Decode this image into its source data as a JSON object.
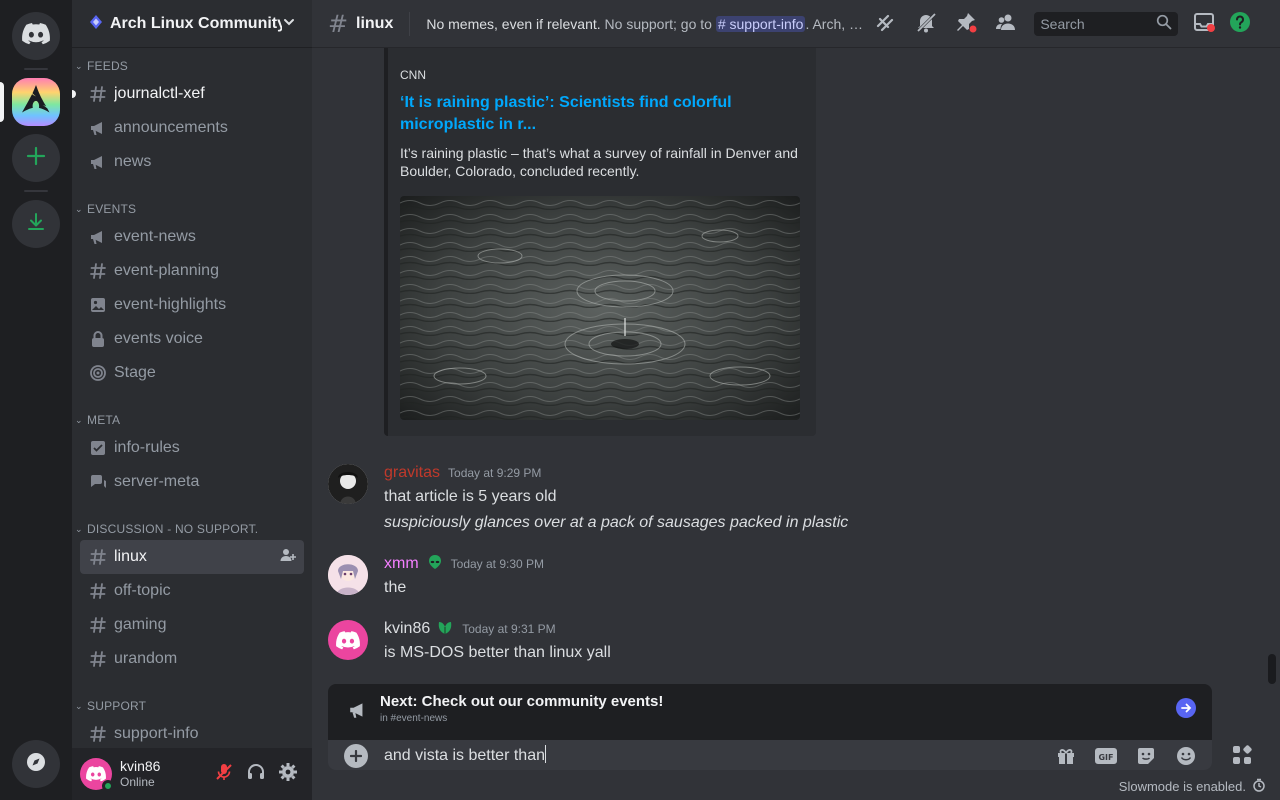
{
  "server": {
    "name": "Arch Linux Community"
  },
  "categories": {
    "feeds": "FEEDS",
    "events": "EVENTS",
    "meta": "META",
    "discussion": "DISCUSSION - NO SUPPORT.",
    "support": "SUPPORT"
  },
  "channels": {
    "journalctl": "journalctl-xef",
    "announcements": "announcements",
    "news": "news",
    "event_news": "event-news",
    "event_planning": "event-planning",
    "event_highlights": "event-highlights",
    "events_voice": "events voice",
    "stage": "Stage",
    "info_rules": "info-rules",
    "server_meta": "server-meta",
    "linux": "linux",
    "off_topic": "off-topic",
    "gaming": "gaming",
    "urandom": "urandom",
    "support_info": "support-info"
  },
  "user": {
    "name": "kvin86",
    "status": "Online"
  },
  "topbar": {
    "channel": "linux",
    "topic_bold": "No memes, even if relevant.",
    "topic_pre": " No support; go to ",
    "topic_mention": "# support-info",
    "topic_post": ". Arch, Linux, open source software and related topics. Off-topic in #off-topic.",
    "search_placeholder": "Search"
  },
  "embed": {
    "provider": "CNN",
    "title": "‘It is raining plastic’: Scientists find colorful microplastic in r...",
    "description": "It’s raining plastic – that’s what a survey of rainfall in Denver and Boulder, Colorado, concluded recently."
  },
  "messages": [
    {
      "author": "gravitas",
      "author_color": "#c0392b",
      "timestamp": "Today at 9:29 PM",
      "line1": "that article is 5 years old",
      "line2": "suspiciously glances over at a pack of sausages packed in plastic"
    },
    {
      "author": "xmm",
      "author_color": "#f47fff",
      "timestamp": "Today at 9:30 PM",
      "line1": "the"
    },
    {
      "author": "kvin86",
      "author_color": "#dbdee1",
      "timestamp": "Today at 9:31 PM",
      "line1": "is MS-DOS better than linux yall"
    }
  ],
  "next_banner": {
    "title": "Next: Check out our community events!",
    "subtitle": "in #event-news"
  },
  "composer": {
    "text": "and vista is better than"
  },
  "slowmode": "Slowmode is enabled.",
  "colors": {
    "accent": "#5865f2",
    "online": "#23a55a",
    "link": "#00a8fc",
    "brand_green": "#23a55a",
    "mention_bg": "#3c4270"
  }
}
